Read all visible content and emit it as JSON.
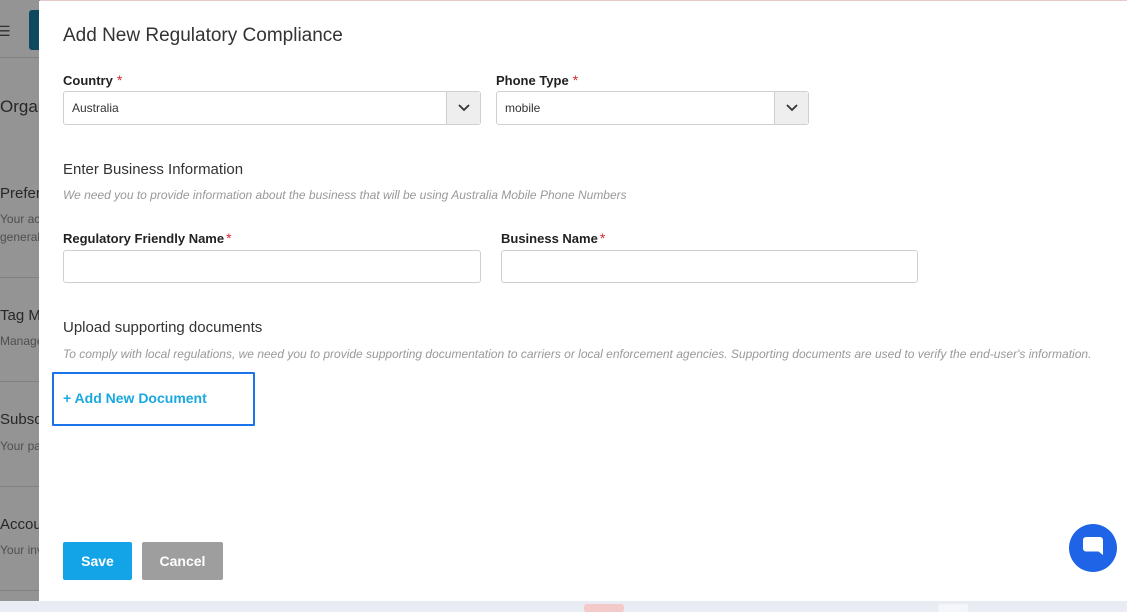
{
  "background": {
    "heading": "Organ",
    "sections": [
      {
        "title": "Prefer",
        "sub1": "Your ac",
        "sub2": "general"
      },
      {
        "title": "Tag Ma",
        "sub1": "Manage"
      },
      {
        "title": "Subscr",
        "sub1": "Your pa"
      },
      {
        "title": "Accour",
        "sub1": "Your inv"
      }
    ]
  },
  "modal": {
    "title": "Add New Regulatory Compliance",
    "country": {
      "label": "Country",
      "required_mark": "*",
      "value": "Australia"
    },
    "phone_type": {
      "label": "Phone Type",
      "required_mark": "*",
      "value": "mobile"
    },
    "business_info": {
      "heading": "Enter Business Information",
      "description": "We need you to provide information about the business that will be using Australia Mobile Phone Numbers"
    },
    "regulatory_friendly_name": {
      "label": "Regulatory Friendly Name",
      "required_mark": "*",
      "value": ""
    },
    "business_name": {
      "label": "Business Name",
      "required_mark": "*",
      "value": ""
    },
    "upload": {
      "heading": "Upload supporting documents",
      "description": "To comply with local regulations, we need you to provide supporting documentation to carriers or local enforcement agencies. Supporting documents are used to verify the end-user's information.",
      "add_link": "+ Add New Document"
    },
    "buttons": {
      "save": "Save",
      "cancel": "Cancel"
    }
  },
  "icons": {
    "select_caret": "chevron-down-icon",
    "chat": "chat-icon"
  },
  "colors": {
    "primary": "#12a4e6",
    "link": "#1aa8e0",
    "required": "#d9262f",
    "focus_outline": "#1a73e8",
    "cancel": "#9e9e9e",
    "chat": "#1f64e6"
  }
}
